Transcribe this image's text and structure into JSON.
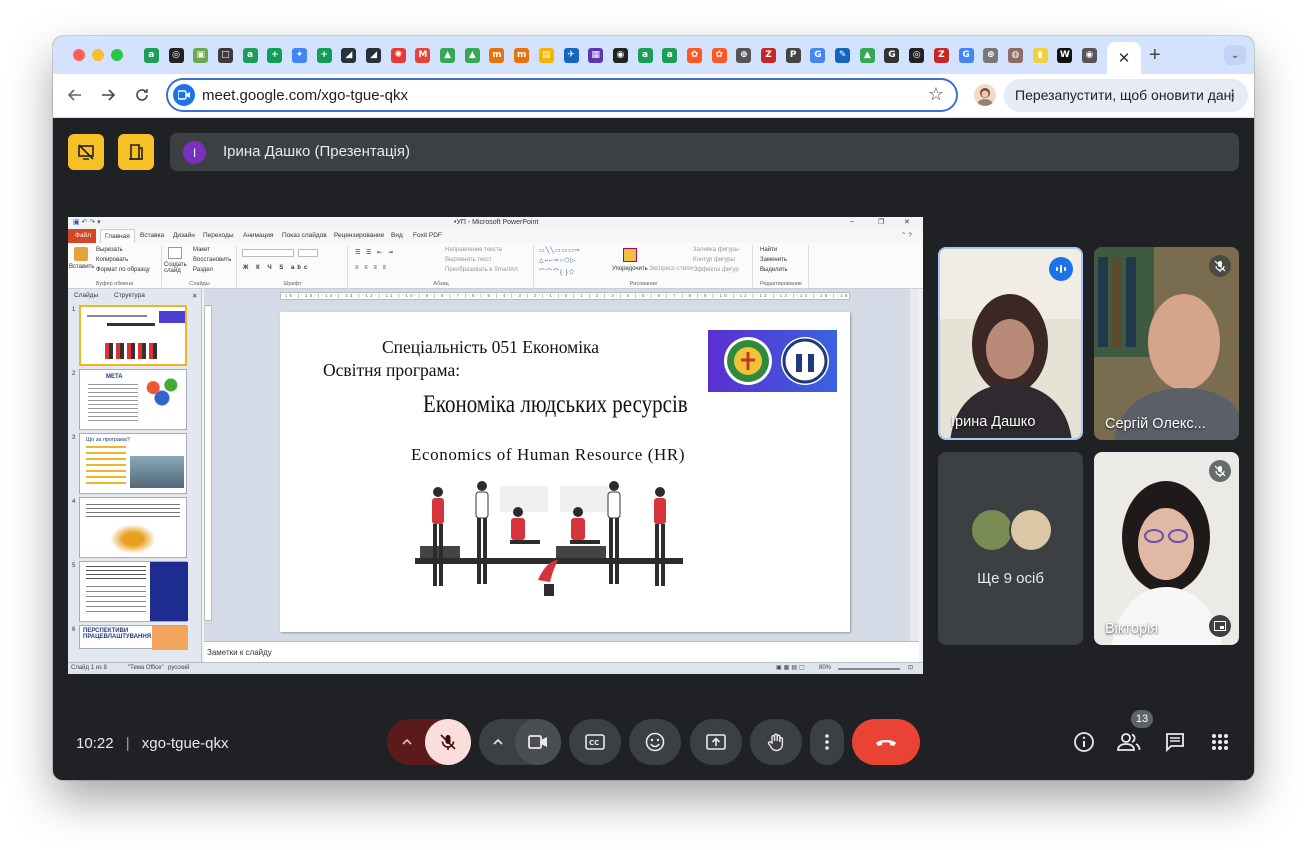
{
  "browser": {
    "tab_icons": [
      {
        "name": "tab-icon-1",
        "color": "#1a9e5a",
        "glyph": "a"
      },
      {
        "name": "tab-icon-2",
        "color": "#222222",
        "glyph": "◎"
      },
      {
        "name": "tab-icon-3",
        "color": "#6aa84f",
        "glyph": "▣"
      },
      {
        "name": "tab-icon-4",
        "color": "#3b3b3b",
        "glyph": "□"
      },
      {
        "name": "tab-icon-5",
        "color": "#1a9e5a",
        "glyph": "a"
      },
      {
        "name": "tab-icon-6",
        "color": "#0f9d58",
        "glyph": "+"
      },
      {
        "name": "tab-icon-7",
        "color": "#4285f4",
        "glyph": "✦"
      },
      {
        "name": "tab-icon-8",
        "color": "#0f9d58",
        "glyph": "+"
      },
      {
        "name": "tab-icon-9",
        "color": "#263238",
        "glyph": "◢"
      },
      {
        "name": "tab-icon-10",
        "color": "#263238",
        "glyph": "◢"
      },
      {
        "name": "tab-icon-11",
        "color": "#e53935",
        "glyph": "✺"
      },
      {
        "name": "tab-icon-12",
        "color": "#ea4335",
        "glyph": "M"
      },
      {
        "name": "tab-icon-13",
        "color": "#34a853",
        "glyph": "▲"
      },
      {
        "name": "tab-icon-14",
        "color": "#34a853",
        "glyph": "▲"
      },
      {
        "name": "tab-icon-15",
        "color": "#e8710a",
        "glyph": "m"
      },
      {
        "name": "tab-icon-16",
        "color": "#e8710a",
        "glyph": "m"
      },
      {
        "name": "tab-icon-17",
        "color": "#f4b400",
        "glyph": "▤"
      },
      {
        "name": "tab-icon-18",
        "color": "#1565c0",
        "glyph": "✈"
      },
      {
        "name": "tab-icon-19",
        "color": "#5e35b1",
        "glyph": "▦"
      },
      {
        "name": "tab-icon-20",
        "color": "#222222",
        "glyph": "◉"
      },
      {
        "name": "tab-icon-21",
        "color": "#1a9e5a",
        "glyph": "a"
      },
      {
        "name": "tab-icon-22",
        "color": "#1a9e5a",
        "glyph": "a"
      },
      {
        "name": "tab-icon-23",
        "color": "#ff5722",
        "glyph": "✿"
      },
      {
        "name": "tab-icon-24",
        "color": "#ff5722",
        "glyph": "✿"
      },
      {
        "name": "tab-icon-25",
        "color": "#555555",
        "glyph": "⊕"
      },
      {
        "name": "tab-icon-26",
        "color": "#c62828",
        "glyph": "Z"
      },
      {
        "name": "tab-icon-27",
        "color": "#444444",
        "glyph": "P"
      },
      {
        "name": "tab-icon-28",
        "color": "#4285f4",
        "glyph": "G"
      },
      {
        "name": "tab-icon-29",
        "color": "#1565c0",
        "glyph": "✎"
      },
      {
        "name": "tab-icon-30",
        "color": "#34a853",
        "glyph": "▲"
      },
      {
        "name": "tab-icon-31",
        "color": "#333333",
        "glyph": "G"
      },
      {
        "name": "tab-icon-32",
        "color": "#222222",
        "glyph": "◎"
      },
      {
        "name": "tab-icon-33",
        "color": "#c62828",
        "glyph": "Z"
      },
      {
        "name": "tab-icon-34",
        "color": "#4285f4",
        "glyph": "G"
      },
      {
        "name": "tab-icon-35",
        "color": "#777777",
        "glyph": "⊕"
      },
      {
        "name": "tab-icon-36",
        "color": "#8d6e63",
        "glyph": "◍"
      },
      {
        "name": "tab-icon-37",
        "color": "#f4d03f",
        "glyph": "▮"
      },
      {
        "name": "tab-icon-38",
        "color": "#111111",
        "glyph": "W"
      },
      {
        "name": "tab-icon-39",
        "color": "#555555",
        "glyph": "◉"
      }
    ],
    "active_tab_close": "✕",
    "new_tab": "+",
    "tab_search": "⌄",
    "url": "meet.google.com/xgo-tgue-qkx",
    "relaunch_label": "Перезапустити, щоб оновити дані",
    "menu_dots": "⋮"
  },
  "meet": {
    "presenter_initial": "І",
    "presenter_label": "Ірина Дашко (Презентація)",
    "participants": [
      {
        "name": "Ірина Дашко",
        "speaking": true
      },
      {
        "name": "Сергій Олекс..."
      },
      {
        "name": "Ще 9 осіб"
      },
      {
        "name": "Вікторія"
      }
    ],
    "time": "10:22",
    "separator": "|",
    "meeting_code": "xgo-tgue-qkx",
    "people_count": "13",
    "colors": {
      "end_call": "#ea4335",
      "mic_off_bg": "#f9dedc",
      "accent_yellow": "#f6c026"
    }
  },
  "ppt": {
    "window_title": "•УП - Microsoft PowerPoint",
    "window_controls": [
      "–",
      "❐",
      "✕"
    ],
    "ribbon_tabs": [
      "Файл",
      "Главная",
      "Вставка",
      "Дизайн",
      "Переходы",
      "Анимация",
      "Показ слайдов",
      "Рецензирование",
      "Вид",
      "Foxit PDF"
    ],
    "clipboard": {
      "paste": "Вставить",
      "cut": "Вырезать",
      "copy": "Копировать",
      "format": "Формат по образцу",
      "group": "Буфер обмена"
    },
    "slides_group": {
      "new": "Создать слайд",
      "layout": "Макет",
      "reset": "Восстановить",
      "section": "Раздел",
      "group": "Слайды"
    },
    "font_group": "Шрифт",
    "paragraph": {
      "direction": "Направление текста",
      "align": "Выровнять текст",
      "smartart": "Преобразовать в SmartArt",
      "group": "Абзац"
    },
    "drawing": {
      "arrange": "Упорядочить",
      "styles": "Экспресс-стили",
      "fill": "Заливка фигуры",
      "outline": "Контур фигуры",
      "effects": "Эффекты фигур",
      "group": "Рисование"
    },
    "editing": {
      "find": "Найти",
      "replace": "Заменить",
      "select": "Выделить",
      "group": "Редактирование"
    },
    "side_tabs": [
      "Слайды",
      "Структура"
    ],
    "thumb_texts": {
      "t2_title": "МЕТА",
      "t3_title": "Що за програма?",
      "t6_title": "ПЕРСПЕКТИВИ ПРАЦЕВЛАШТУВАННЯ"
    },
    "ruler_text": "·16·|·15·|·14·|·13·|·12·|·11·|·10·|·9·|·8·|·7·|·6·|·5·|·4·|·3·|·2·|·1·|·0·|·1·|·2·|·3·|·4·|·5·|·6·|·7·|·8·|·9·|·10·|·11·|·12·|·13·|·14·|·15·|·16·",
    "slide": {
      "line1": "Спеціальність 051 Економіка",
      "line2": "Освітня програма:",
      "title": "Економіка людських ресурсів",
      "subtitle": "Economics of Human Resource (HR)"
    },
    "notes_placeholder": "Заметки к слайду",
    "status": {
      "slide_of": "Слайд 1 из 8",
      "theme": "\"Тема Office\"",
      "lang": "русский",
      "zoom": "80%"
    }
  }
}
